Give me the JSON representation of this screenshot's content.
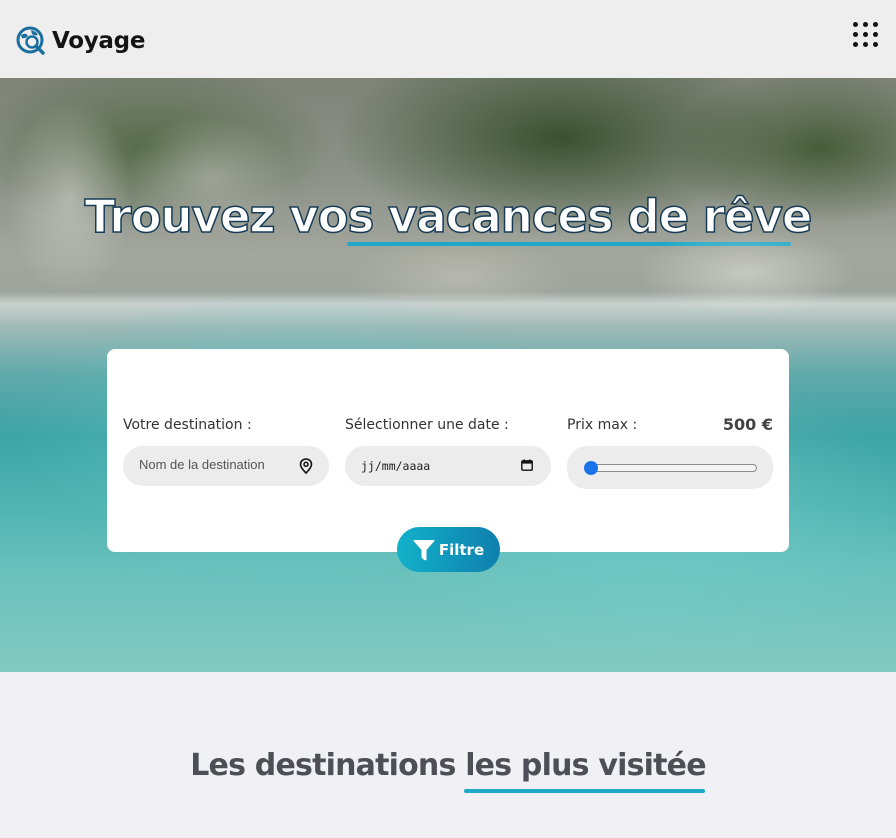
{
  "header": {
    "brand": "Voyage",
    "logo_icon": "globe-search-icon",
    "menu_icon": "grid-menu-icon"
  },
  "hero": {
    "title": "Trouvez vos vacances de rêve"
  },
  "search": {
    "destination_label": "Votre destination :",
    "destination_placeholder": "Nom de la destination",
    "date_label": "Sélectionner une date :",
    "date_value": "jj/mm/aaaa",
    "price_label": "Prix max :",
    "price_value": "500 €",
    "price_slider_fraction": 0,
    "filter_label": "Filtre"
  },
  "destinations": {
    "title": "Les destinations les plus visitée"
  },
  "colors": {
    "accent": "#1fa9c6",
    "button_start": "#12b1c9",
    "button_end": "#0f7fae",
    "slider_thumb": "#1a73e8"
  }
}
